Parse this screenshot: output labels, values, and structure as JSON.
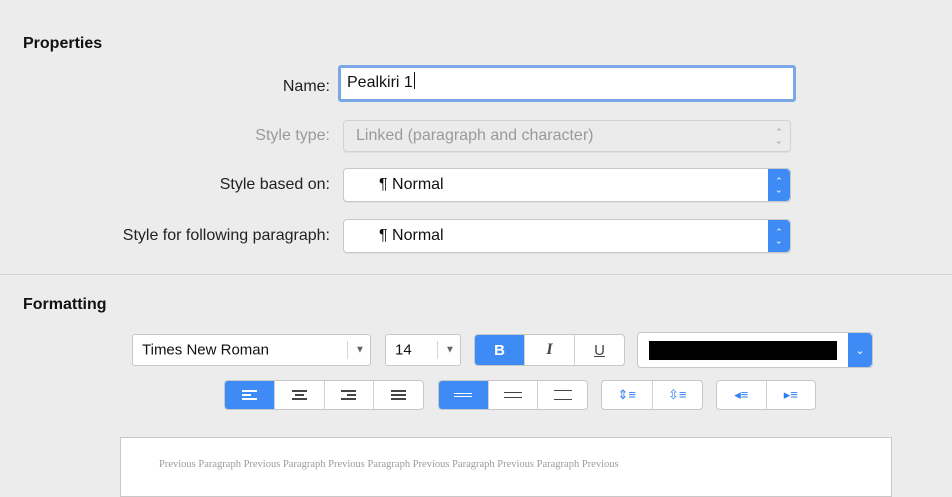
{
  "properties": {
    "section_title": "Properties",
    "name_label": "Name:",
    "name_value": "Pealkiri 1",
    "style_type_label": "Style type:",
    "style_type_value": "Linked (paragraph and character)",
    "style_based_on_label": "Style based on:",
    "style_based_on_value": "Normal",
    "following_label": "Style for following paragraph:",
    "following_value": "Normal",
    "paragraph_mark": "¶"
  },
  "formatting": {
    "section_title": "Formatting",
    "font_name": "Times New Roman",
    "font_size": "14",
    "bold_label": "B",
    "italic_label": "I",
    "underline_label": "U",
    "font_color": "#000000",
    "selected_alignment": "left",
    "selected_line_spacing": "single"
  },
  "preview": {
    "text": "Previous Paragraph Previous Paragraph Previous Paragraph Previous Paragraph Previous Paragraph Previous"
  },
  "colors": {
    "accent": "#3f8bf5",
    "focus_ring": "#7aa7e6"
  }
}
